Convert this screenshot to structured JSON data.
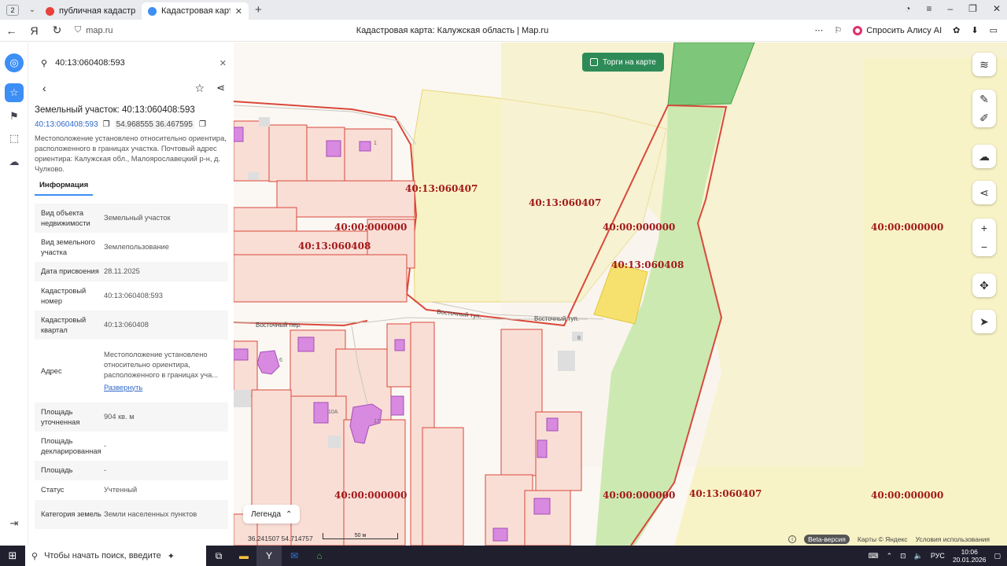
{
  "browser": {
    "tab_count": "2",
    "tabs": [
      {
        "title": "публичная кадастровая к",
        "fav_color": "#e8413c",
        "active": false
      },
      {
        "title": "Кадастровая карта: Ка",
        "fav_color": "#3d8ef5",
        "active": true
      }
    ],
    "url": "map.ru",
    "page_title": "Кадастровая карта: Калужская область | Map.ru",
    "alice_label": "Спросить Алису AI"
  },
  "panel": {
    "search_value": "40:13:060408:593",
    "title": "Земельный участок: 40:13:060408:593",
    "id_link": "40:13:060408:593",
    "coords": "54.968555 36.467595",
    "description": "Местоположение установлено относительно ориентира, расположенного в границах участка. Почтовый адрес ориентира: Калужская обл., Малоярославецкий р-н, д. Чулково.",
    "info_tab": "Информация",
    "properties": [
      {
        "key": "Вид объекта недвижимости",
        "value": "Земельный участок"
      },
      {
        "key": "Вид земельного участка",
        "value": "Землепользование"
      },
      {
        "key": "Дата присвоения",
        "value": "28.11.2025"
      },
      {
        "key": "Кадастровый номер",
        "value": "40:13:060408:593"
      },
      {
        "key": "Кадастровый квартал",
        "value": "40:13:060408"
      },
      {
        "key": "Адрес",
        "value": "Местоположение установлено относительно ориентира, расположенного в границах уча...",
        "more": "Развернуть"
      },
      {
        "key": "Площадь уточненная",
        "value": "904 кв. м"
      },
      {
        "key": "Площадь декларированная",
        "value": "-"
      },
      {
        "key": "Площадь",
        "value": "-"
      },
      {
        "key": "Статус",
        "value": "Учтенный"
      },
      {
        "key": "Категория земель",
        "value": "Земли населенных пунктов"
      }
    ]
  },
  "map": {
    "torgi_label": "Торги на карте",
    "legend_label": "Легенда",
    "coords_readout": "36.241507  54.714757",
    "scale_label": "50 м",
    "beta_label": "Beta-версия",
    "attribution": "Карты © Яндекс",
    "terms": "Условия использования",
    "labels": [
      {
        "text": "40:13:060407"
      },
      {
        "text": "40:13:060407"
      },
      {
        "text": "40:00:000000"
      },
      {
        "text": "40:00:000000"
      },
      {
        "text": "40:00:000000"
      },
      {
        "text": "40:13:060408"
      },
      {
        "text": "40:13:060408"
      },
      {
        "text": "40:00:000000"
      },
      {
        "text": "40:00:000000"
      },
      {
        "text": "40:13:060407"
      },
      {
        "text": "40:00:000000"
      }
    ],
    "streets": [
      "Восточный пер.",
      "Восточный туп.",
      "Восточный туп."
    ],
    "house_numbers": [
      "1",
      "8",
      "6",
      "10А",
      "17"
    ]
  },
  "taskbar": {
    "search_placeholder": "Чтобы начать поиск, введите",
    "lang": "РУС",
    "time": "10:06",
    "date": "20.01.2026"
  },
  "colors": {
    "accent": "#3d8ef5",
    "parcel_line": "#d9483b",
    "label": "#a11a1a",
    "green": "#2e8b57"
  }
}
